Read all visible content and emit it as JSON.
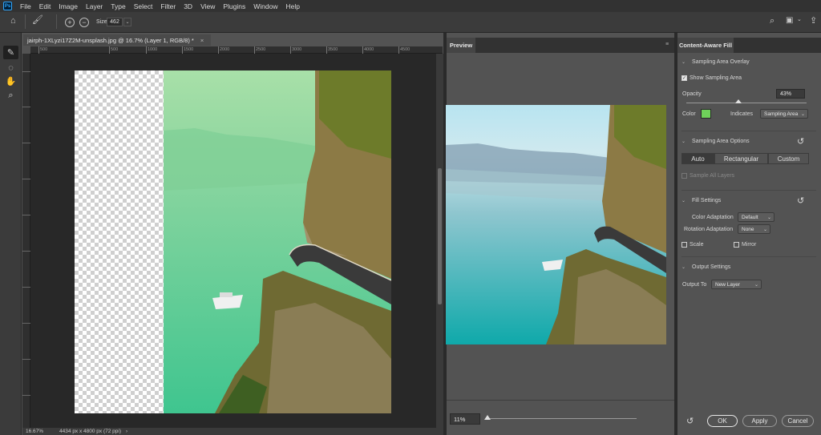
{
  "app": {
    "logo": "Ps"
  },
  "menu": [
    "File",
    "Edit",
    "Image",
    "Layer",
    "Type",
    "Select",
    "Filter",
    "3D",
    "View",
    "Plugins",
    "Window",
    "Help"
  ],
  "options_bar": {
    "size_label": "Size",
    "size_value": "462"
  },
  "document": {
    "tab_title": "jairph-1XLyzi17Z2M-unsplash.jpg @ 16.7% (Layer 1, RGB/8) *",
    "ruler_ticks": [
      "500",
      "500",
      "1000",
      "1500",
      "2000",
      "2500",
      "3000",
      "3500",
      "4000",
      "4500"
    ],
    "ruler_left": [
      "0",
      "5",
      "1",
      "1",
      "2",
      "2",
      "3",
      "3",
      "4",
      "4"
    ],
    "status_zoom": "16.67%",
    "status_info": "4434 px x 4800 px (72 ppi)"
  },
  "preview": {
    "tab": "Preview",
    "zoom": "11%",
    "zoom_fraction": 0.01
  },
  "content_aware_fill": {
    "tab": "Content-Aware Fill",
    "sampling_overlay": {
      "header": "Sampling Area Overlay",
      "show_label": "Show Sampling Area",
      "show_checked": true,
      "opacity_label": "Opacity",
      "opacity_value": "43%",
      "opacity_fraction": 0.43,
      "color_label": "Color",
      "color": "#6fd15a",
      "indicates_label": "Indicates",
      "indicates_value": "Sampling Area"
    },
    "sampling_options": {
      "header": "Sampling Area Options",
      "modes": [
        "Auto",
        "Rectangular",
        "Custom"
      ],
      "active_mode": "Auto",
      "sample_all_layers": "Sample All Layers"
    },
    "fill_settings": {
      "header": "Fill Settings",
      "color_adaptation_label": "Color Adaptation",
      "color_adaptation_value": "Default",
      "rotation_adaptation_label": "Rotation Adaptation",
      "rotation_adaptation_value": "None",
      "scale_label": "Scale",
      "mirror_label": "Mirror"
    },
    "output_settings": {
      "header": "Output Settings",
      "output_to_label": "Output To",
      "output_to_value": "New Layer"
    },
    "buttons": {
      "ok": "OK",
      "apply": "Apply",
      "cancel": "Cancel"
    }
  }
}
